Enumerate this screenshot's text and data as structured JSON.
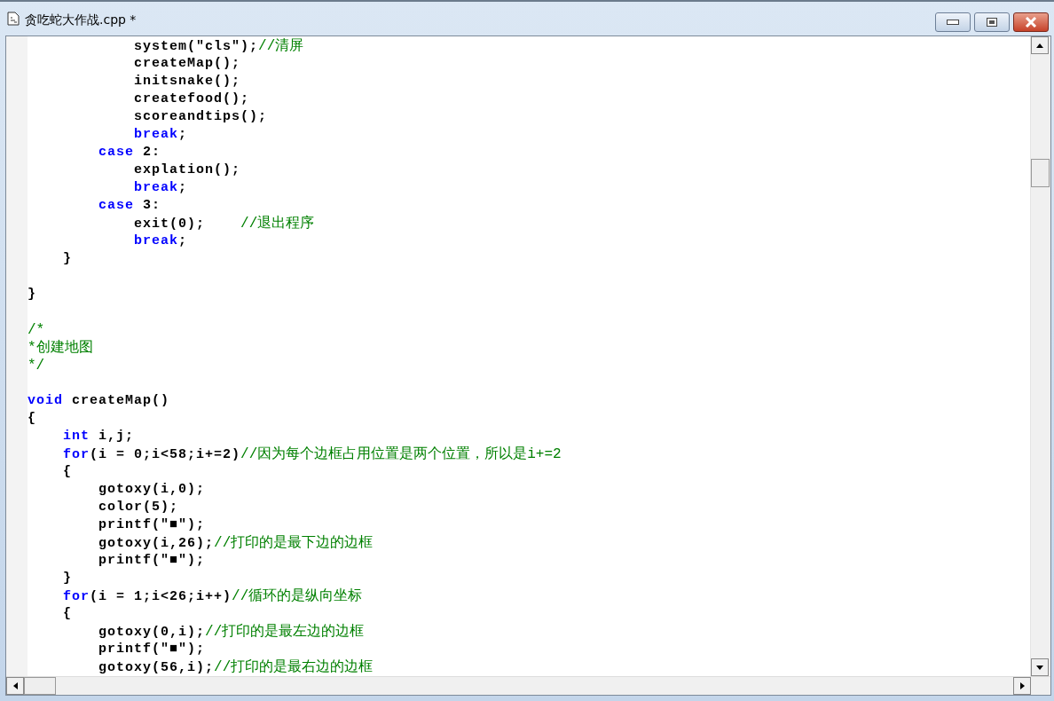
{
  "window": {
    "title": "贪吃蛇大作战.cpp *"
  },
  "code_lines": [
    {
      "kind": "code",
      "tokens": [
        {
          "kind": "plain",
          "text": "            system(\"cls\");"
        },
        {
          "kind": "comment",
          "text": "//清屏"
        }
      ]
    },
    {
      "kind": "code",
      "tokens": [
        {
          "kind": "plain",
          "text": "            createMap();"
        }
      ]
    },
    {
      "kind": "code",
      "tokens": [
        {
          "kind": "plain",
          "text": "            initsnake();"
        }
      ]
    },
    {
      "kind": "code",
      "tokens": [
        {
          "kind": "plain",
          "text": "            createfood();"
        }
      ]
    },
    {
      "kind": "code",
      "tokens": [
        {
          "kind": "plain",
          "text": "            scoreandtips();"
        }
      ]
    },
    {
      "kind": "code",
      "tokens": [
        {
          "kind": "keyword",
          "text": "            break"
        },
        {
          "kind": "plain",
          "text": ";"
        }
      ]
    },
    {
      "kind": "code",
      "tokens": [
        {
          "kind": "keyword",
          "text": "        case"
        },
        {
          "kind": "plain",
          "text": " 2:"
        }
      ]
    },
    {
      "kind": "code",
      "tokens": [
        {
          "kind": "plain",
          "text": "            explation();"
        }
      ]
    },
    {
      "kind": "code",
      "tokens": [
        {
          "kind": "keyword",
          "text": "            break"
        },
        {
          "kind": "plain",
          "text": ";"
        }
      ]
    },
    {
      "kind": "code",
      "tokens": [
        {
          "kind": "keyword",
          "text": "        case"
        },
        {
          "kind": "plain",
          "text": " 3:"
        }
      ]
    },
    {
      "kind": "code",
      "tokens": [
        {
          "kind": "plain",
          "text": "            exit(0);    "
        },
        {
          "kind": "comment",
          "text": "//退出程序"
        }
      ]
    },
    {
      "kind": "code",
      "tokens": [
        {
          "kind": "keyword",
          "text": "            break"
        },
        {
          "kind": "plain",
          "text": ";"
        }
      ]
    },
    {
      "kind": "code",
      "tokens": [
        {
          "kind": "plain",
          "text": "    }"
        }
      ]
    },
    {
      "kind": "blank"
    },
    {
      "kind": "code",
      "tokens": [
        {
          "kind": "plain",
          "text": "}"
        }
      ]
    },
    {
      "kind": "blank"
    },
    {
      "kind": "code",
      "tokens": [
        {
          "kind": "comment",
          "text": "/*"
        }
      ]
    },
    {
      "kind": "code",
      "tokens": [
        {
          "kind": "comment",
          "text": "*创建地图"
        }
      ]
    },
    {
      "kind": "code",
      "tokens": [
        {
          "kind": "comment",
          "text": "*/"
        }
      ]
    },
    {
      "kind": "blank"
    },
    {
      "kind": "code",
      "tokens": [
        {
          "kind": "keyword",
          "text": "void"
        },
        {
          "kind": "plain",
          "text": " createMap()"
        }
      ]
    },
    {
      "kind": "code",
      "tokens": [
        {
          "kind": "plain",
          "text": "{"
        }
      ]
    },
    {
      "kind": "code",
      "tokens": [
        {
          "kind": "keyword",
          "text": "    int"
        },
        {
          "kind": "plain",
          "text": " i,j;"
        }
      ]
    },
    {
      "kind": "code",
      "tokens": [
        {
          "kind": "keyword",
          "text": "    for"
        },
        {
          "kind": "plain",
          "text": "(i = 0;i<58;i+=2)"
        },
        {
          "kind": "comment",
          "text": "//因为每个边框占用位置是两个位置，所以是i+=2"
        }
      ]
    },
    {
      "kind": "code",
      "tokens": [
        {
          "kind": "plain",
          "text": "    {"
        }
      ]
    },
    {
      "kind": "code",
      "tokens": [
        {
          "kind": "plain",
          "text": "        gotoxy(i,0);"
        }
      ]
    },
    {
      "kind": "code",
      "tokens": [
        {
          "kind": "plain",
          "text": "        color(5);"
        }
      ]
    },
    {
      "kind": "code",
      "tokens": [
        {
          "kind": "plain",
          "text": "        printf(\"■\");"
        }
      ]
    },
    {
      "kind": "code",
      "tokens": [
        {
          "kind": "plain",
          "text": "        gotoxy(i,26);"
        },
        {
          "kind": "comment",
          "text": "//打印的是最下边的边框"
        }
      ]
    },
    {
      "kind": "code",
      "tokens": [
        {
          "kind": "plain",
          "text": "        printf(\"■\");"
        }
      ]
    },
    {
      "kind": "code",
      "tokens": [
        {
          "kind": "plain",
          "text": "    }"
        }
      ]
    },
    {
      "kind": "code",
      "tokens": [
        {
          "kind": "keyword",
          "text": "    for"
        },
        {
          "kind": "plain",
          "text": "(i = 1;i<26;i++)"
        },
        {
          "kind": "comment",
          "text": "//循环的是纵向坐标"
        }
      ]
    },
    {
      "kind": "code",
      "tokens": [
        {
          "kind": "plain",
          "text": "    {"
        }
      ]
    },
    {
      "kind": "code",
      "tokens": [
        {
          "kind": "plain",
          "text": "        gotoxy(0,i);"
        },
        {
          "kind": "comment",
          "text": "//打印的是最左边的边框"
        }
      ]
    },
    {
      "kind": "code",
      "tokens": [
        {
          "kind": "plain",
          "text": "        printf(\"■\");"
        }
      ]
    },
    {
      "kind": "code",
      "tokens": [
        {
          "kind": "plain",
          "text": "        gotoxy(56,i);"
        },
        {
          "kind": "comment",
          "text": "//打印的是最右边的边框"
        }
      ]
    }
  ]
}
